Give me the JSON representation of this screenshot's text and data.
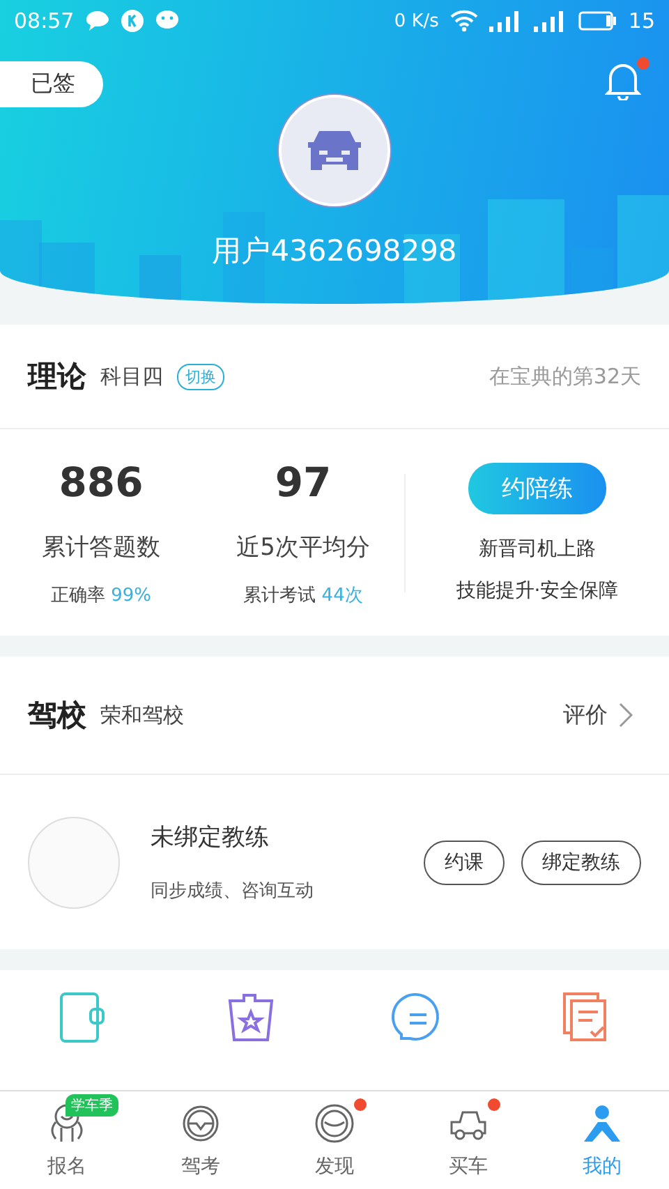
{
  "status_bar": {
    "time": "08:57",
    "speed": "0 K/s",
    "battery": "15"
  },
  "header": {
    "sign_badge": "已签",
    "notification_unread": true,
    "username": "用户4362698298"
  },
  "theory": {
    "title": "理论",
    "subject": "科目四",
    "switch": "切换",
    "days": "在宝典的第32天",
    "stats": [
      {
        "value": "886",
        "label": "累计答题数",
        "sub_label": "正确率",
        "sub_value": "99%"
      },
      {
        "value": "97",
        "label": "近5次平均分",
        "sub_label": "累计考试",
        "sub_value": "44次"
      }
    ],
    "promo": {
      "button": "约陪练",
      "lines": [
        "新晋司机上路",
        "技能提升·安全保障"
      ]
    }
  },
  "school": {
    "title": "驾校",
    "name": "荣和驾校",
    "action": "评价"
  },
  "coach": {
    "title": "未绑定教练",
    "subtitle": "同步成绩、咨询互动",
    "buttons": [
      "约课",
      "绑定教练"
    ]
  },
  "shortcuts": [
    {
      "kind": "notebook"
    },
    {
      "kind": "favorites"
    },
    {
      "kind": "chat"
    },
    {
      "kind": "records"
    }
  ],
  "tabs": [
    {
      "kind": "signup",
      "label": "报名",
      "badge": "学车季",
      "dot": false,
      "selected": false
    },
    {
      "kind": "wheel",
      "label": "驾考",
      "dot": false,
      "selected": false
    },
    {
      "kind": "discover",
      "label": "发现",
      "dot": true,
      "selected": false
    },
    {
      "kind": "car",
      "label": "买车",
      "dot": true,
      "selected": false
    },
    {
      "kind": "me",
      "label": "我的",
      "dot": false,
      "selected": true
    }
  ]
}
